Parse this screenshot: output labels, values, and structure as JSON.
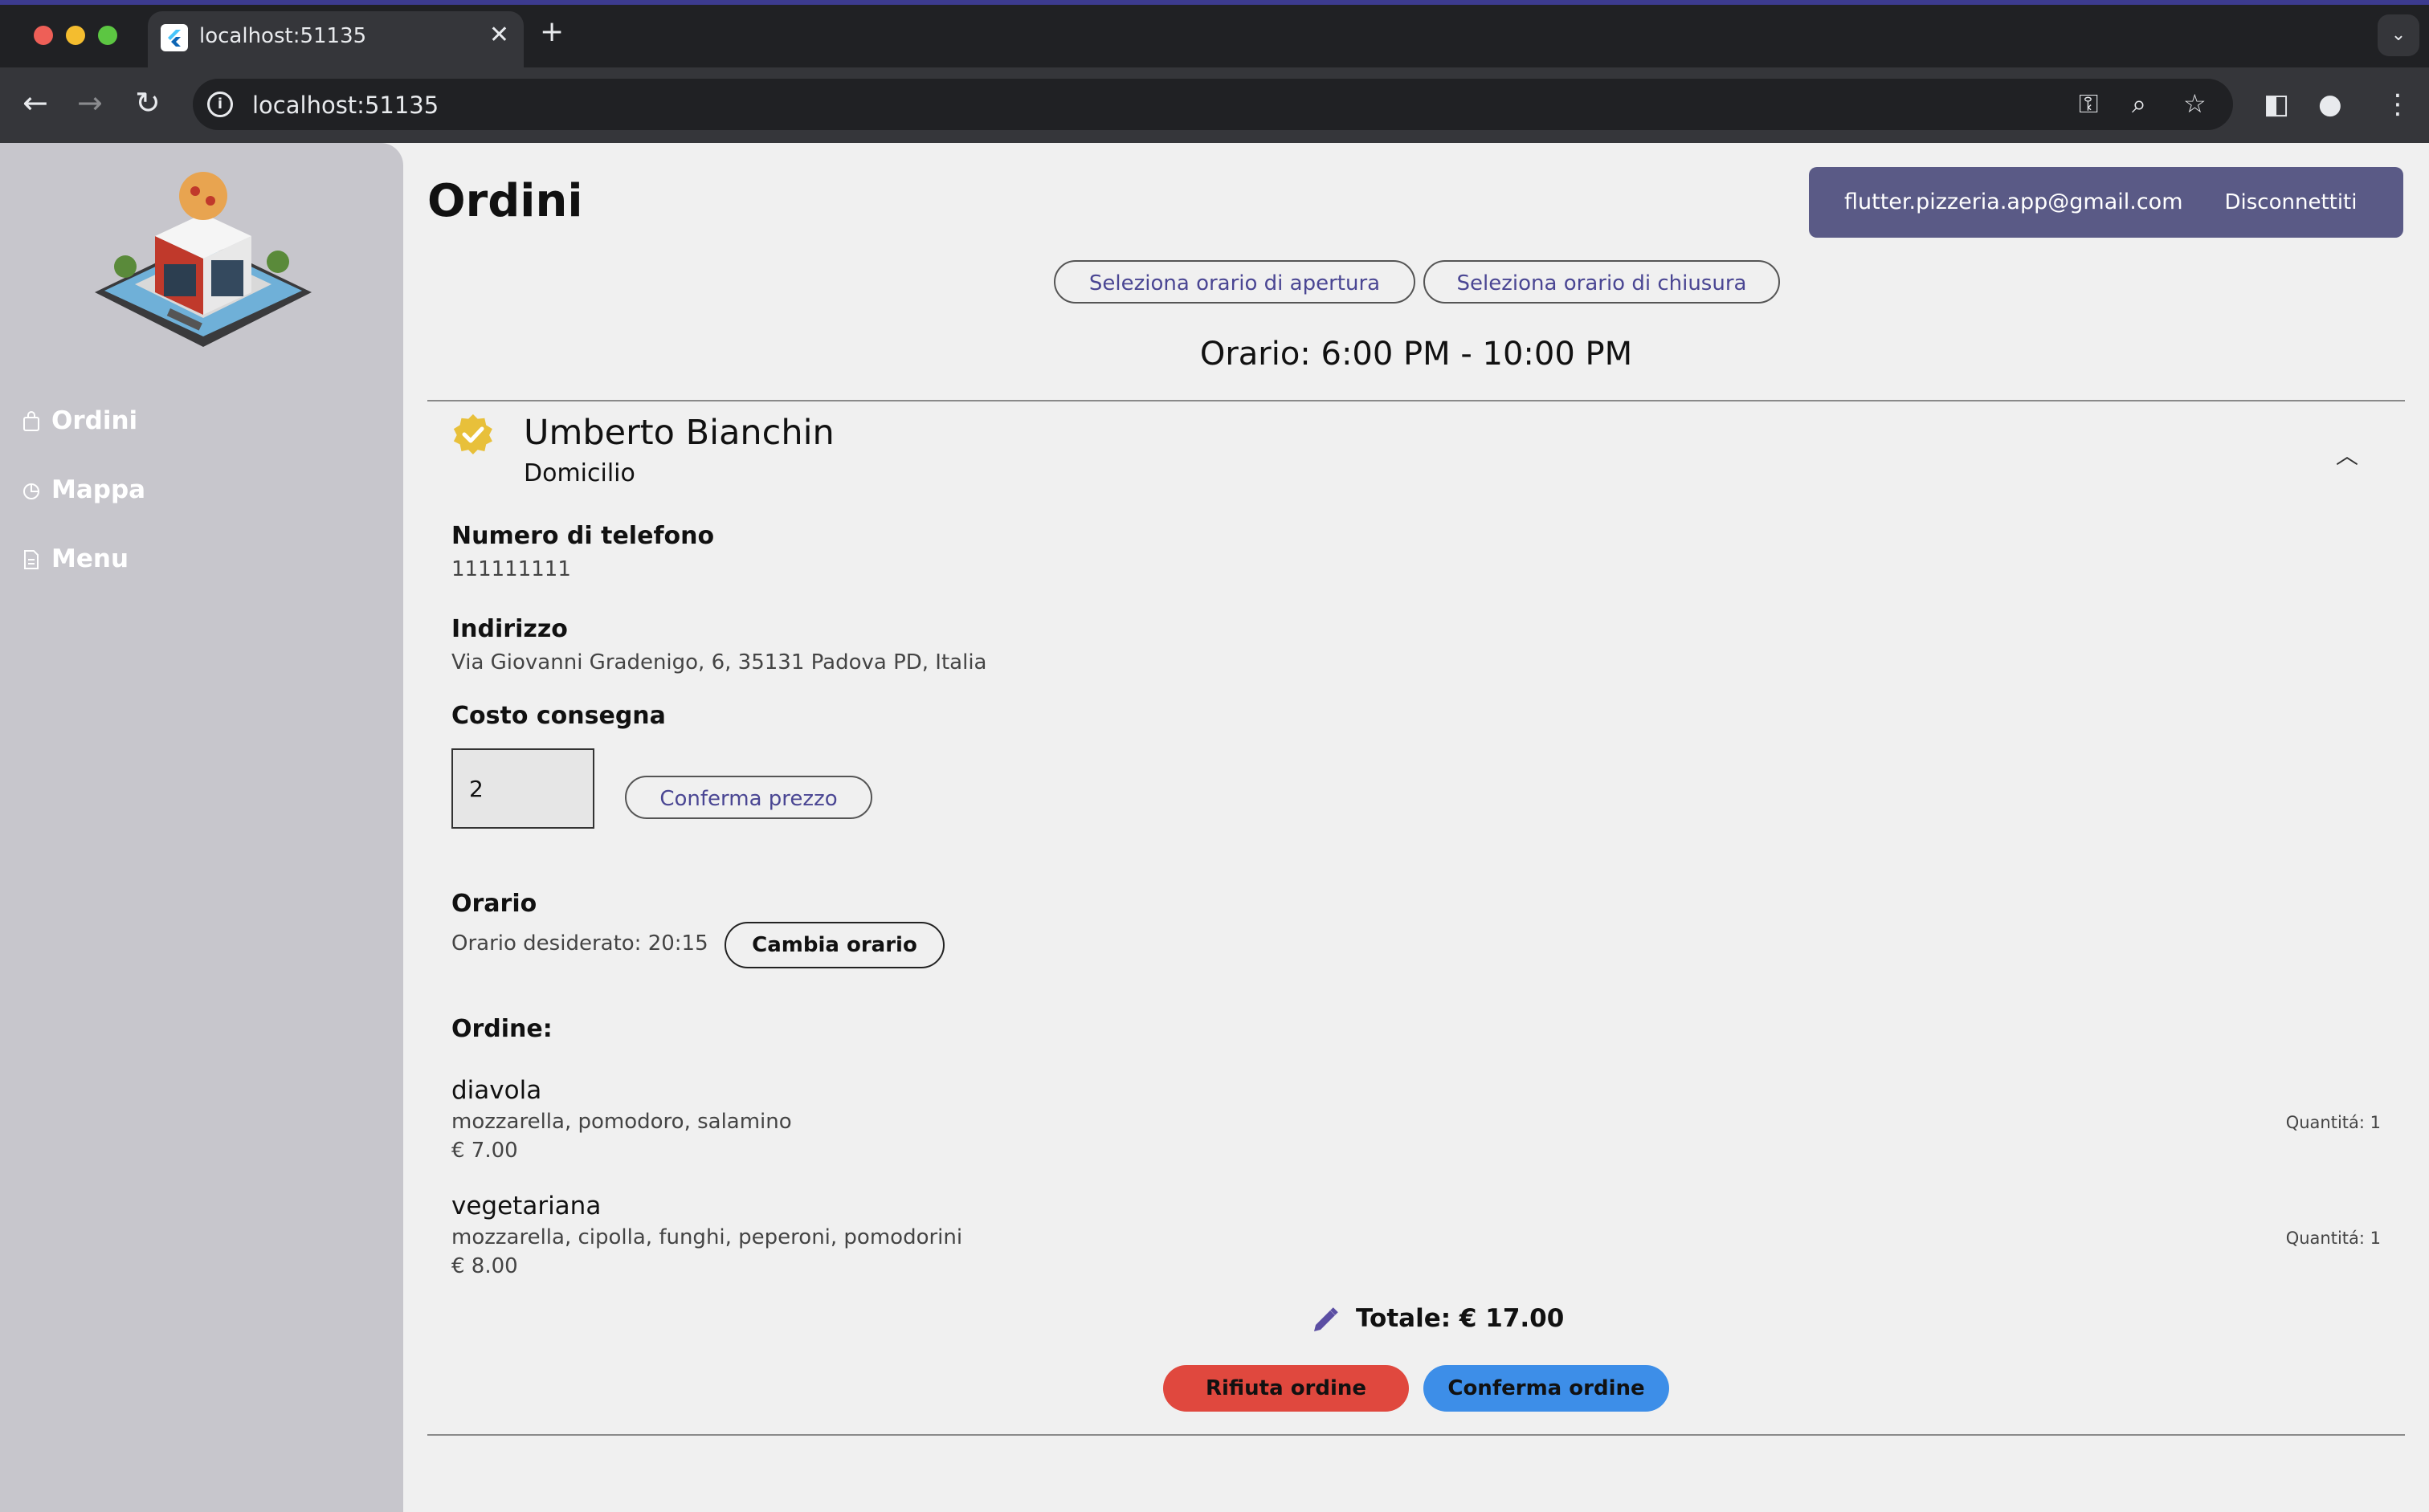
{
  "browser": {
    "tab_title": "localhost:51135",
    "tab_close": "✕",
    "new_tab": "+",
    "url": "localhost:51135"
  },
  "sidebar": {
    "items": [
      {
        "label": "Ordini",
        "icon": "bag-icon"
      },
      {
        "label": "Mappa",
        "icon": "pie-chart-icon"
      },
      {
        "label": "Menu",
        "icon": "document-icon"
      }
    ]
  },
  "header": {
    "title": "Ordini",
    "account_email": "flutter.pizzeria.app@gmail.com",
    "logout_label": "Disconnettiti"
  },
  "schedule": {
    "open_button": "Seleziona orario di apertura",
    "close_button": "Seleziona orario di chiusura",
    "text": "Orario: 6:00 PM - 10:00 PM"
  },
  "order": {
    "customer_name": "Umberto Bianchin",
    "type": "Domicilio",
    "phone_label": "Numero di telefono",
    "phone_value": "111111111",
    "address_label": "Indirizzo",
    "address_value": "Via Giovanni Gradenigo, 6, 35131 Padova PD, Italia",
    "delivery_cost_label": "Costo consegna",
    "delivery_cost_value": "2",
    "confirm_price_button": "Conferma prezzo",
    "time_label": "Orario",
    "desired_time": "Orario desiderato: 20:15",
    "change_time_button": "Cambia orario",
    "order_label": "Ordine:",
    "items": [
      {
        "name": "diavola",
        "ingredients": "mozzarella, pomodoro, salamino",
        "price": "€ 7.00",
        "quantity": "Quantitá: 1"
      },
      {
        "name": "vegetariana",
        "ingredients": "mozzarella, cipolla, funghi, peperoni, pomodorini",
        "price": "€ 8.00",
        "quantity": "Quantitá: 1"
      }
    ],
    "total": "Totale: € 17.00",
    "reject_button": "Rifiuta ordine",
    "confirm_button": "Conferma ordine"
  },
  "colors": {
    "accent": "#4a4693",
    "account_bg": "#5a5a86",
    "reject": "#e0483e",
    "confirm": "#3d8ee8",
    "verified": "#e8c03a"
  }
}
